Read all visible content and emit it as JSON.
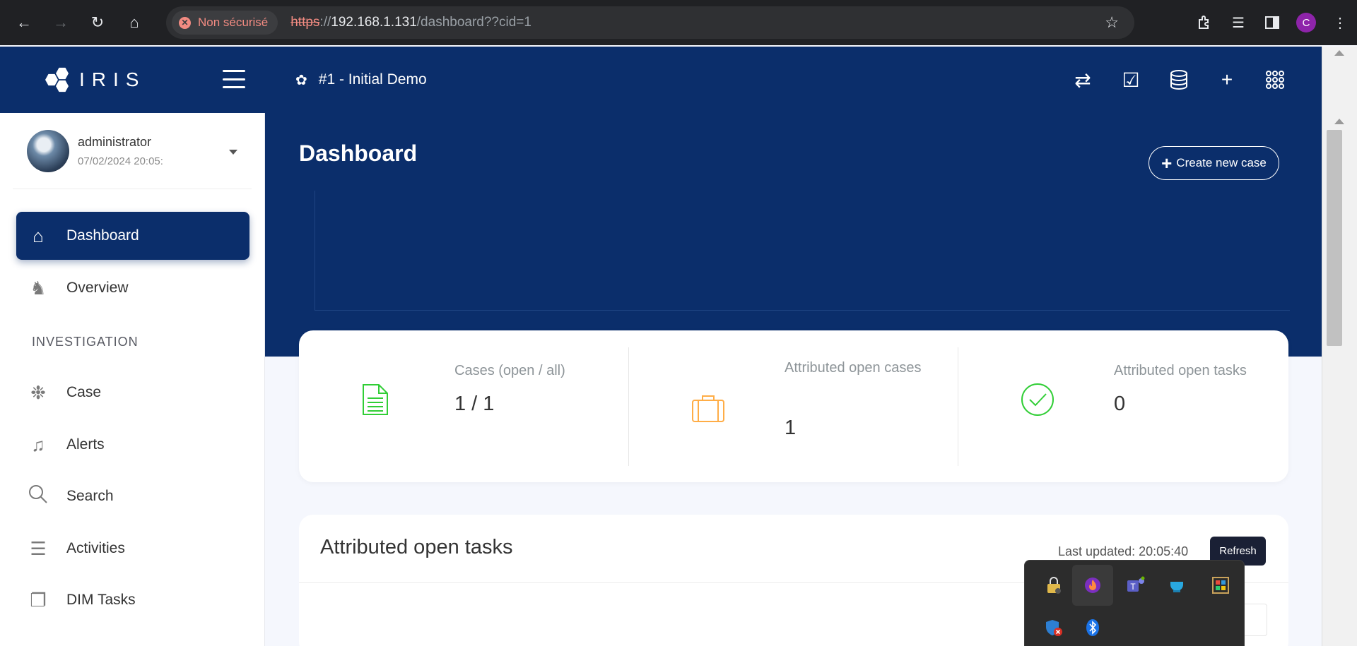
{
  "browser": {
    "security_label": "Non sécurisé",
    "url_scheme": "https",
    "url_sep": "://",
    "url_host": "192.168.1.131",
    "url_path": "/dashboard??cid=1",
    "profile_initial": "C"
  },
  "app": {
    "brand": "IRIS",
    "case_title": "#1 - Initial Demo"
  },
  "user": {
    "name": "administrator",
    "timestamp": "07/02/2024 20:05:"
  },
  "sidebar": {
    "items": [
      {
        "label": "Dashboard",
        "icon": "home-icon",
        "active": true
      },
      {
        "label": "Overview",
        "icon": "overview-icon",
        "active": false
      }
    ],
    "section": "INVESTIGATION",
    "investigation_items": [
      {
        "label": "Case",
        "icon": "case-network-icon"
      },
      {
        "label": "Alerts",
        "icon": "bell-icon"
      },
      {
        "label": "Search",
        "icon": "search-icon"
      },
      {
        "label": "Activities",
        "icon": "activities-list-icon"
      },
      {
        "label": "DIM Tasks",
        "icon": "dim-tasks-icon"
      }
    ]
  },
  "main": {
    "page_title": "Dashboard",
    "create_case_label": "Create new case",
    "stats": [
      {
        "label": "Cases (open / all)",
        "value": "1 / 1",
        "icon": "document-icon",
        "color": "#31ce36"
      },
      {
        "label": "Attributed open cases",
        "value": "1",
        "icon": "briefcase-icon",
        "color": "#ffad46"
      },
      {
        "label": "Attributed open tasks",
        "value": "0",
        "icon": "check-circle-icon",
        "color": "#31ce36"
      }
    ],
    "tasks": {
      "title": "Attributed open tasks",
      "last_updated": "Last updated: 20:05:40",
      "refresh_label": "Refresh"
    }
  },
  "colors": {
    "brand_navy": "#0b2e6b",
    "success_green": "#31ce36",
    "warning_orange": "#ffad46"
  }
}
